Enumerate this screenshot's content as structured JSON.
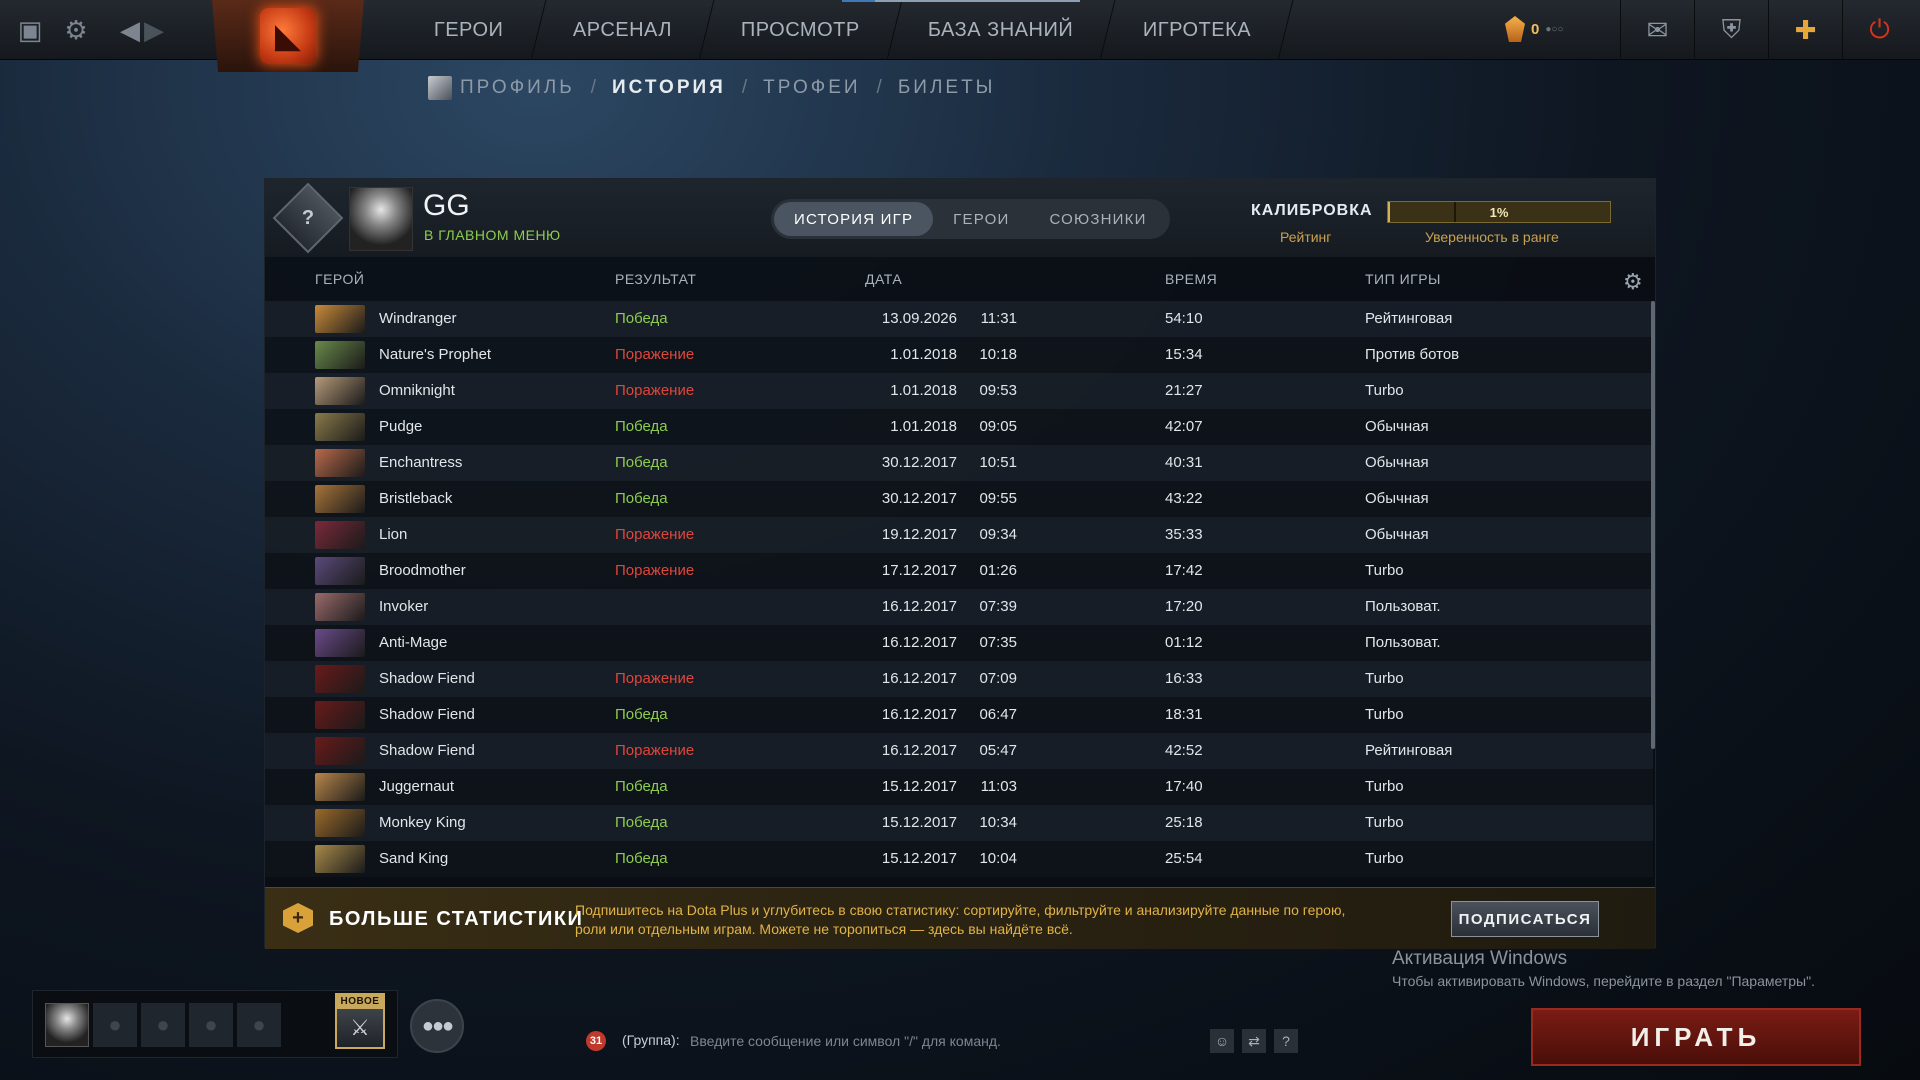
{
  "topbar": {
    "nav": [
      "ГЕРОИ",
      "АРСЕНАЛ",
      "ПРОСМОТР",
      "БАЗА ЗНАНИЙ",
      "ИГРОТЕКА"
    ],
    "shards": "0"
  },
  "breadcrumb": {
    "items": [
      "ПРОФИЛЬ",
      "ИСТОРИЯ",
      "ТРОФЕИ",
      "БИЛЕТЫ"
    ],
    "separator": "/"
  },
  "profile": {
    "name": "GG",
    "status": "В ГЛАВНОМ МЕНЮ",
    "tabs": [
      "ИСТОРИЯ ИГР",
      "ГЕРОИ",
      "СОЮЗНИКИ"
    ],
    "calibration_label": "КАЛИБРОВКА",
    "rating_label": "Рейтинг",
    "confidence_label": "Уверенность в ранге",
    "confidence_value": "1%",
    "confidence_fraction": 0.01
  },
  "table": {
    "headers": [
      "ГЕРОЙ",
      "РЕЗУЛЬТАТ",
      "ДАТА",
      "ВРЕМЯ",
      "ТИП ИГРЫ"
    ],
    "rows": [
      {
        "hero": "Windranger",
        "result": "Победа",
        "outcome": "win",
        "date": "13.09.2026",
        "time": "11:31",
        "duration": "54:10",
        "type": "Рейтинговая",
        "color": "#c98a3a"
      },
      {
        "hero": "Nature's Prophet",
        "result": "Поражение",
        "outcome": "loss",
        "date": "1.01.2018",
        "time": "10:18",
        "duration": "15:34",
        "type": "Против ботов",
        "color": "#6a8a4a"
      },
      {
        "hero": "Omniknight",
        "result": "Поражение",
        "outcome": "loss",
        "date": "1.01.2018",
        "time": "09:53",
        "duration": "21:27",
        "type": "Turbo",
        "color": "#b59a7a"
      },
      {
        "hero": "Pudge",
        "result": "Победа",
        "outcome": "win",
        "date": "1.01.2018",
        "time": "09:05",
        "duration": "42:07",
        "type": "Обычная",
        "color": "#8a7a4a"
      },
      {
        "hero": "Enchantress",
        "result": "Победа",
        "outcome": "win",
        "date": "30.12.2017",
        "time": "10:51",
        "duration": "40:31",
        "type": "Обычная",
        "color": "#b86a4a"
      },
      {
        "hero": "Bristleback",
        "result": "Победа",
        "outcome": "win",
        "date": "30.12.2017",
        "time": "09:55",
        "duration": "43:22",
        "type": "Обычная",
        "color": "#a8743a"
      },
      {
        "hero": "Lion",
        "result": "Поражение",
        "outcome": "loss",
        "date": "19.12.2017",
        "time": "09:34",
        "duration": "35:33",
        "type": "Обычная",
        "color": "#7a2a3a"
      },
      {
        "hero": "Broodmother",
        "result": "Поражение",
        "outcome": "loss",
        "date": "17.12.2017",
        "time": "01:26",
        "duration": "17:42",
        "type": "Turbo",
        "color": "#5a4a7a"
      },
      {
        "hero": "Invoker",
        "result": "",
        "outcome": "none",
        "date": "16.12.2017",
        "time": "07:39",
        "duration": "17:20",
        "type": "Пользоват.",
        "color": "#9a6a6a"
      },
      {
        "hero": "Anti-Mage",
        "result": "",
        "outcome": "none",
        "date": "16.12.2017",
        "time": "07:35",
        "duration": "01:12",
        "type": "Пользоват.",
        "color": "#6a4a8a"
      },
      {
        "hero": "Shadow Fiend",
        "result": "Поражение",
        "outcome": "loss",
        "date": "16.12.2017",
        "time": "07:09",
        "duration": "16:33",
        "type": "Turbo",
        "color": "#6a1a1a"
      },
      {
        "hero": "Shadow Fiend",
        "result": "Победа",
        "outcome": "win",
        "date": "16.12.2017",
        "time": "06:47",
        "duration": "18:31",
        "type": "Turbo",
        "color": "#6a1a1a"
      },
      {
        "hero": "Shadow Fiend",
        "result": "Поражение",
        "outcome": "loss",
        "date": "16.12.2017",
        "time": "05:47",
        "duration": "42:52",
        "type": "Рейтинговая",
        "color": "#6a1a1a"
      },
      {
        "hero": "Juggernaut",
        "result": "Победа",
        "outcome": "win",
        "date": "15.12.2017",
        "time": "11:03",
        "duration": "17:40",
        "type": "Turbo",
        "color": "#b8864a"
      },
      {
        "hero": "Monkey King",
        "result": "Победа",
        "outcome": "win",
        "date": "15.12.2017",
        "time": "10:34",
        "duration": "25:18",
        "type": "Turbo",
        "color": "#9a6a2a"
      },
      {
        "hero": "Sand King",
        "result": "Победа",
        "outcome": "win",
        "date": "15.12.2017",
        "time": "10:04",
        "duration": "25:54",
        "type": "Turbo",
        "color": "#a88a4a"
      }
    ]
  },
  "promo": {
    "title": "БОЛЬШЕ СТАТИСТИКИ",
    "text": "Подпишитесь на Dota Plus и углубитесь в свою статистику: сортируйте, фильтруйте и анализируйте данные по герою, роли или отдельным играм. Можете не торопиться — здесь вы найдёте всё.",
    "button": "ПОДПИСАТЬСЯ"
  },
  "windows_activation": {
    "title": "Активация Windows",
    "subtitle": "Чтобы активировать Windows, перейдите в раздел \"Параметры\"."
  },
  "bottom": {
    "new_badge": "НОВОЕ",
    "chat_badge": "31",
    "chat_channel": "(Группа):",
    "chat_placeholder": "Введите сообщение или символ \"/\" для команд.",
    "play": "ИГРАТЬ"
  },
  "colors": {
    "win": "#8ccd4f",
    "loss": "#e0453a",
    "accent_gold": "#c9a24e",
    "play_red": "#7a1c14"
  }
}
